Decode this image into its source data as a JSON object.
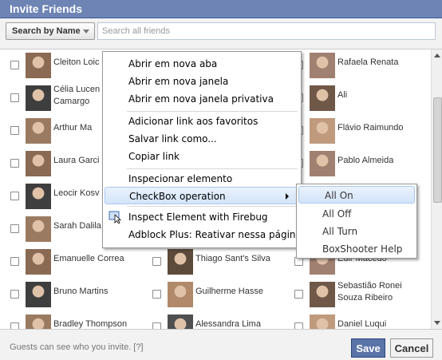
{
  "dialog": {
    "title": "Invite Friends"
  },
  "filter": {
    "dropdown_label": "Search by Name",
    "search_placeholder": "Search all friends"
  },
  "friends_rows": [
    [
      {
        "name": "Cleiton Loic"
      },
      {
        "name": ""
      },
      {
        "name": "Rafaela Renata"
      }
    ],
    [
      {
        "name": "Célia Lucen\nCamargo"
      },
      {
        "name": ""
      },
      {
        "name": "Ali"
      }
    ],
    [
      {
        "name": "Arthur Ma"
      },
      {
        "name": ""
      },
      {
        "name": "Flávio Raimundo"
      }
    ],
    [
      {
        "name": "Laura Garci"
      },
      {
        "name": ""
      },
      {
        "name": "Pablo Almeida"
      }
    ],
    [
      {
        "name": "Leocir Kosv"
      },
      {
        "name": ""
      },
      {
        "name": ""
      }
    ],
    [
      {
        "name": "Sarah Dalila"
      },
      {
        "name": ""
      },
      {
        "name": ""
      }
    ],
    [
      {
        "name": "Emanuelle Correa"
      },
      {
        "name": "Thiago Sant's Silva"
      },
      {
        "name": "Edir Macedo"
      }
    ],
    [
      {
        "name": "Bruno Martins"
      },
      {
        "name": "Guilherme Hasse"
      },
      {
        "name": "Sebastião Ronei\nSouza Ribeiro"
      }
    ],
    [
      {
        "name": "Bradley Thompson"
      },
      {
        "name": "Alessandra Lima"
      },
      {
        "name": "Daniel Luqui"
      }
    ]
  ],
  "context_menu": {
    "items": [
      "Abrir em nova aba",
      "Abrir em nova janela",
      "Abrir em nova janela privativa",
      "Adicionar link aos favoritos",
      "Salvar link como...",
      "Copiar link",
      "Inspecionar elemento",
      "CheckBox operation",
      "Inspect Element with Firebug",
      "Adblock Plus: Reativar nessa página"
    ]
  },
  "submenu": {
    "items": [
      "All On",
      "All Off",
      "All Turn",
      "BoxShooter Help"
    ]
  },
  "footer": {
    "note": "Guests can see who you invite. [?]",
    "save_label": "Save",
    "cancel_label": "Cancel"
  },
  "colors": {
    "title_bar": "#6d84b4",
    "save_button": "#5b74a8",
    "highlight": "#d3e4fa"
  }
}
